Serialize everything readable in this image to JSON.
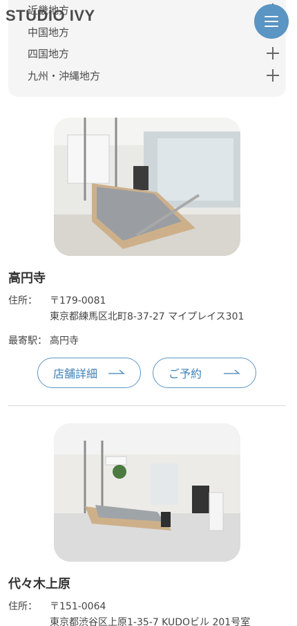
{
  "brand": {
    "logo_text": "STUDIO IVY",
    "accent": "#5a95c4"
  },
  "header": {
    "menu_icon": "hamburger-icon"
  },
  "regions": [
    {
      "label": "近畿地方"
    },
    {
      "label": "中国地方"
    },
    {
      "label": "四国地方"
    },
    {
      "label": "九州・沖縄地方"
    }
  ],
  "studios": [
    {
      "name": "高円寺",
      "address_label": "住所：",
      "postal": "〒179-0081",
      "address": "東京都練馬区北町8-37-27 マイプレイス301",
      "station_label": "最寄駅：",
      "station": "高円寺",
      "detail_button": "店舗詳細",
      "reserve_button": "ご予約"
    },
    {
      "name": "代々木上原",
      "address_label": "住所：",
      "postal": "〒151-0064",
      "address": "東京都渋谷区上原1-35-7 KUDOビル 201号室"
    }
  ]
}
